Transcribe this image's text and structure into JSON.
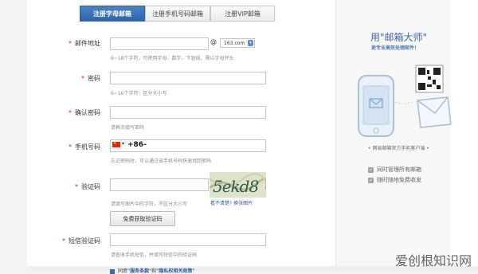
{
  "tabs": [
    {
      "label": "注册字母邮箱",
      "active": true
    },
    {
      "label": "注册手机号码邮箱",
      "active": false
    },
    {
      "label": "注册VIP邮箱",
      "active": false
    }
  ],
  "form": {
    "required_mark": "*",
    "email": {
      "label": "邮件地址",
      "at_sign": "@",
      "domain": "163.com",
      "hint": "6~18个字符，可使用字母、数字、下划线，需以字母开头"
    },
    "password": {
      "label": "密码",
      "hint": "6~16个字符，区分大小写"
    },
    "confirm": {
      "label": "确认密码",
      "hint": "请再次填写密码"
    },
    "phone": {
      "label": "手机号码",
      "flag_caret": "▾",
      "prefix": "+86-",
      "hint": "忘记密码时，可以通过该手机号码快速找回密码"
    },
    "captcha": {
      "label": "验证码",
      "image_text": "5ekd8",
      "hint": "请填写图片中的字符，不区分大小写",
      "refresh_text": "看不清楚? 换张图片",
      "free_button": "免费获取验证码"
    },
    "sms": {
      "label": "短信验证码",
      "hint": "请查收手机短信，并填写短信中的验证码"
    },
    "agree": {
      "prefix": "同意",
      "terms": "\"服务条款\"",
      "and": "和",
      "privacy": "\"隐私权相关政策\""
    }
  },
  "promo": {
    "title": "用\"邮箱大师\"",
    "subtitle": "更专业高效处理邮件！",
    "caption": "• 网易邮箱官方手机客户端 •",
    "features": [
      "同时管理所有邮箱",
      "随时随地免费收发"
    ]
  },
  "watermark": "爱创根知识网",
  "colors": {
    "accent": "#2f63a8",
    "required": "#d8222b",
    "link": "#2a5a9e",
    "flag": "#de2910"
  }
}
